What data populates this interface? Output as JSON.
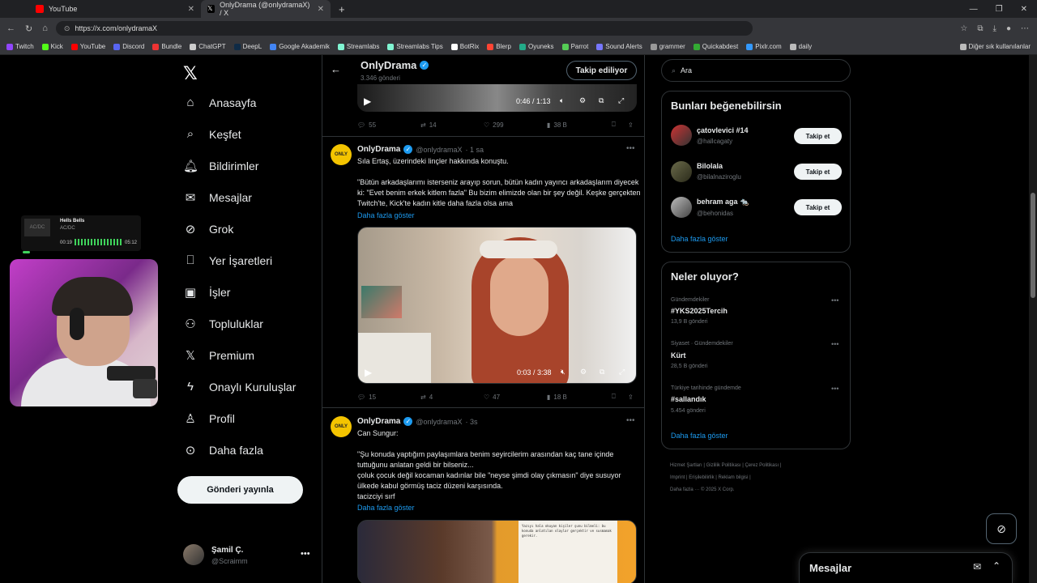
{
  "browser": {
    "tabs": [
      {
        "label": "YouTube",
        "active": false
      },
      {
        "label": "OnlyDrama (@onlydramaX) / X",
        "active": true
      }
    ],
    "url": "https://x.com/onlydramaX",
    "bookmarks": [
      "Twitch",
      "Kick",
      "YouTube",
      "Discord",
      "Bundle",
      "ChatGPT",
      "DeepL",
      "Google Akademik",
      "Streamlabs",
      "Streamlabs Tips",
      "BotRix",
      "Blerp",
      "Oyuneks",
      "Parrot",
      "Sound Alerts",
      "grammer",
      "Quickabdest",
      "Pixlr.com",
      "daily"
    ],
    "bookmarks_other": "Diğer sık kullanılanlar"
  },
  "stream_overlay": {
    "art_text": "AC/DC",
    "song": "Hells Bells",
    "artist": "AC/DC",
    "time_elapsed": "00:19",
    "time_total": "05:12"
  },
  "nav": {
    "items": [
      {
        "label": "Anasayfa",
        "icon": "home-icon"
      },
      {
        "label": "Keşfet",
        "icon": "search-icon"
      },
      {
        "label": "Bildirimler",
        "icon": "bell-icon"
      },
      {
        "label": "Mesajlar",
        "icon": "mail-icon"
      },
      {
        "label": "Grok",
        "icon": "grok-icon"
      },
      {
        "label": "Yer İşaretleri",
        "icon": "bookmark-icon"
      },
      {
        "label": "İşler",
        "icon": "briefcase-icon"
      },
      {
        "label": "Topluluklar",
        "icon": "people-icon"
      },
      {
        "label": "Premium",
        "icon": "x-icon"
      },
      {
        "label": "Onaylı Kuruluşlar",
        "icon": "lightning-icon"
      },
      {
        "label": "Profil",
        "icon": "person-icon"
      },
      {
        "label": "Daha fazla",
        "icon": "more-circle-icon"
      }
    ],
    "post_button": "Gönderi yayınla",
    "user_name": "Şamil Ç.",
    "user_handle": "@Scraimm"
  },
  "profile_header": {
    "name": "OnlyDrama",
    "post_count": "3.346 gönderi",
    "follow_button": "Takip ediliyor"
  },
  "video_top": {
    "time": "0:46 / 1:13"
  },
  "tweet0_actions": {
    "replies": "55",
    "retweets": "14",
    "likes": "299",
    "views": "38 B"
  },
  "tweet1": {
    "name": "OnlyDrama",
    "handle": "@onlydramaX",
    "time": "· 1 sa",
    "text": "Sıla Ertaş, üzerindeki linçler hakkında konuştu.\n\n\"Bütün arkadaşlarımı isterseniz arayıp sorun, bütün kadın yayıncı arkadaşlarım diyecek ki: \"Evet benim erkek kitlem fazla\" Bu bizim elimizde olan bir şey değil. Keşke gerçekten Twitch'te, Kick'te kadın kitle daha fazla olsa ama",
    "show_more": "Daha fazla göster",
    "video_time": "0:03 / 3:38",
    "replies": "15",
    "retweets": "4",
    "likes": "47",
    "views": "18 B"
  },
  "tweet2": {
    "name": "OnlyDrama",
    "handle": "@onlydramaX",
    "time": "· 3s",
    "text": "Can Sungur:\n\n\"Şu konuda yaptığım paylaşımlara benim seyircilerim arasından kaç tane içinde tuttuğunu anlatan geldi bir bilseniz...\nçoluk çocuk değil kocaman kadınlar bile \"neyse şimdi olay çıkmasın\" diye susuyor ülkede kabul görmüş taciz düzeni karşısında.\ntacizciyi sırf",
    "show_more": "Daha fazla göster",
    "paper_text": "Yazıyı hala okuyan kişiler şunu bilmeli: bu konuda anlatılan olaylar gerçektir ve susmamak gerekir."
  },
  "search": {
    "placeholder": "Ara"
  },
  "suggestions": {
    "title": "Bunları beğenebilirsin",
    "users": [
      {
        "name": "çatovlevici #14",
        "handle": "@hallcagaty",
        "button": "Takip et"
      },
      {
        "name": "Bilolala",
        "handle": "@bilalnaziroglu",
        "button": "Takip et"
      },
      {
        "name": "behram aga 🐀",
        "handle": "@behonidas",
        "button": "Takip et"
      }
    ],
    "show_more": "Daha fazla göster"
  },
  "trends": {
    "title": "Neler oluyor?",
    "items": [
      {
        "context": "Gündemdekiler",
        "name": "#YKS2025Tercih",
        "posts": "13,9 B gönderi"
      },
      {
        "context": "Siyaset · Gündemdekiler",
        "name": "Kürt",
        "posts": "28,5 B gönderi"
      },
      {
        "context": "Türkiye tarihinde gündemde",
        "name": "#sallandık",
        "posts": "5.454 gönderi"
      }
    ],
    "show_more": "Daha fazla göster"
  },
  "footer": {
    "line1": "Hizmet Şartları  |  Gizlilik Politikası  |  Çerez Politikası  |",
    "line2": "Imprint  |  Erişilebilirlik  |  Reklam bilgisi  |",
    "line3": "Daha fazla ···   © 2025 X Corp."
  },
  "messages_drawer": {
    "title": "Mesajlar"
  }
}
